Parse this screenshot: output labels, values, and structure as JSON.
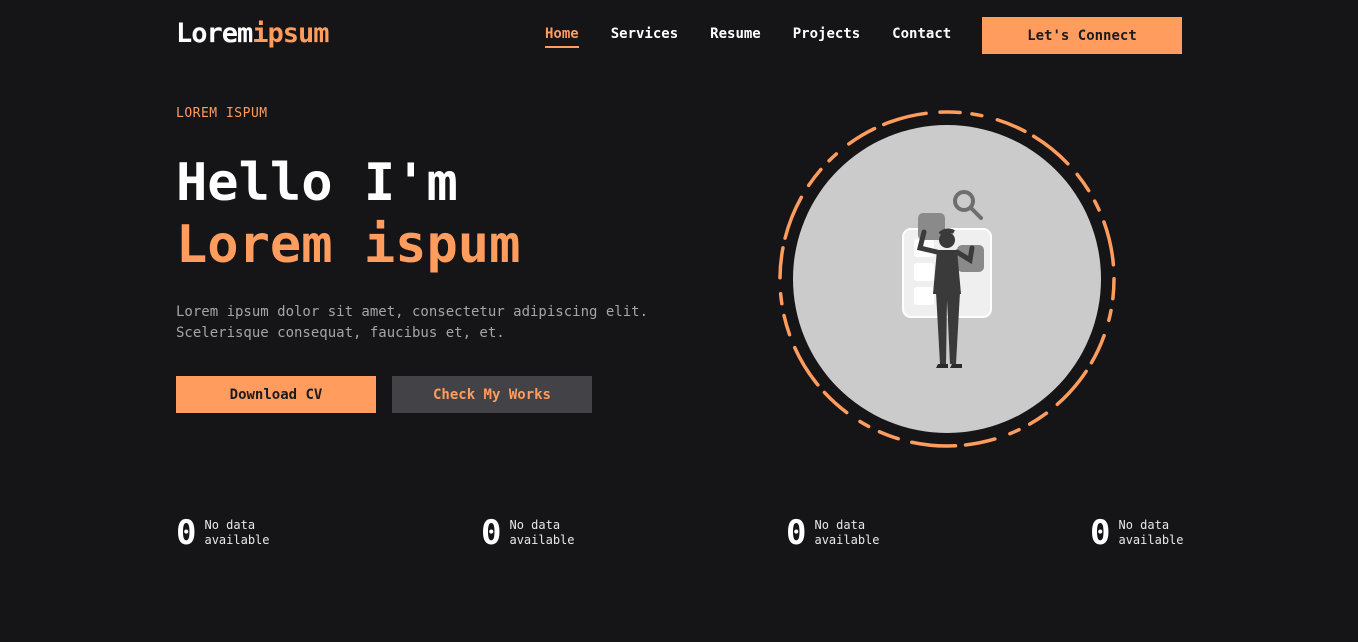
{
  "header": {
    "logo_part1": "Lorem",
    "logo_part2": "ipsum",
    "nav": [
      {
        "label": "Home",
        "active": true
      },
      {
        "label": "Services",
        "active": false
      },
      {
        "label": "Resume",
        "active": false
      },
      {
        "label": "Projects",
        "active": false
      },
      {
        "label": "Contact",
        "active": false
      }
    ],
    "cta_label": "Let's Connect"
  },
  "hero": {
    "eyebrow": "LOREM ISPUM",
    "title_line1": "Hello I'm",
    "title_line2": "Lorem ispum",
    "description_line1": "Lorem ipsum dolor sit amet, consectetur adipiscing elit.",
    "description_line2": "Scelerisque consequat, faucibus et, et.",
    "primary_button": "Download CV",
    "secondary_button": "Check My Works",
    "illustration_icon": "person-with-search-icon"
  },
  "stats": [
    {
      "value": "0",
      "label_line1": "No data",
      "label_line2": "available"
    },
    {
      "value": "0",
      "label_line1": "No data",
      "label_line2": "available"
    },
    {
      "value": "0",
      "label_line1": "No data",
      "label_line2": "available"
    },
    {
      "value": "0",
      "label_line1": "No data",
      "label_line2": "available"
    }
  ],
  "colors": {
    "background": "#151417",
    "accent": "#ff9c5e",
    "secondary_button": "#434347",
    "text_muted": "#a5a5a8",
    "circle": "#cbcbcb"
  }
}
